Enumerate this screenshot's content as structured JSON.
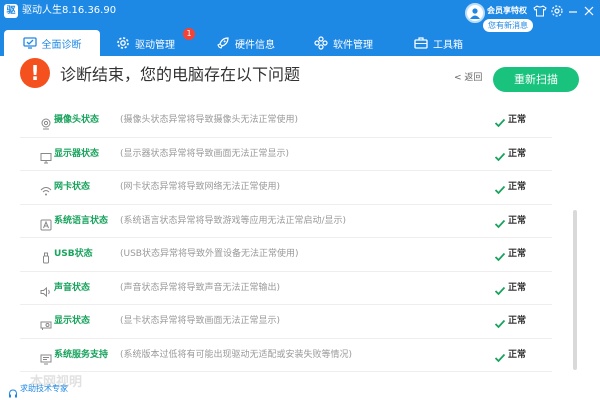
{
  "app": {
    "title": "驱动人生8.16.36.90"
  },
  "member": {
    "vip_text": "会员享特权",
    "tag_text": "您有新消息"
  },
  "tabs": [
    {
      "label": "全面诊断",
      "active": true
    },
    {
      "label": "驱动管理",
      "badge": "1"
    },
    {
      "label": "硬件信息"
    },
    {
      "label": "软件管理"
    },
    {
      "label": "工具箱"
    }
  ],
  "diagnosis": {
    "title": "诊断结束，您的电脑存在以下问题",
    "back_label": "返回",
    "rescan_label": "重新扫描"
  },
  "items": [
    {
      "name": "摄像头状态",
      "desc": "(摄像头状态异常将导致摄像头无法正常使用)",
      "status": "正常",
      "icon": "camera-icon"
    },
    {
      "name": "显示器状态",
      "desc": "(显示器状态异常将导致画面无法正常显示)",
      "status": "正常",
      "icon": "monitor-icon"
    },
    {
      "name": "网卡状态",
      "desc": "(网卡状态异常将导致网络无法正常使用)",
      "status": "正常",
      "icon": "wifi-icon"
    },
    {
      "name": "系统语言状态",
      "desc": "(系统语言状态异常将导致游戏等应用无法正常启动/显示)",
      "status": "正常",
      "icon": "language-icon"
    },
    {
      "name": "USB状态",
      "desc": "(USB状态异常将导致外置设备无法正常使用)",
      "status": "正常",
      "icon": "usb-icon"
    },
    {
      "name": "声音状态",
      "desc": "(声音状态异常将导致声音无法正常输出)",
      "status": "正常",
      "icon": "speaker-icon"
    },
    {
      "name": "显示状态",
      "desc": "(显卡状态异常将导致画面无法正常显示)",
      "status": "正常",
      "icon": "display-card-icon"
    },
    {
      "name": "系统服务支持",
      "desc": "(系统版本过低将有可能出现驱动无适配或安装失败等情况)",
      "status": "正常",
      "icon": "system-icon"
    }
  ],
  "footer": {
    "help_label": "求助技术专家",
    "watermark": "本网视明"
  },
  "colors": {
    "header": "#1e88e5",
    "accent_green": "#19c37d",
    "status_green": "#19a35d",
    "alert": "#f4511e",
    "badge": "#f44336"
  }
}
